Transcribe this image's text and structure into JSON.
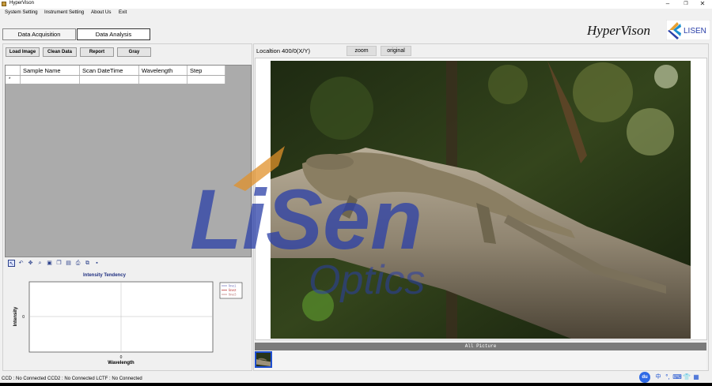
{
  "window": {
    "title": "HyperVison",
    "controls": [
      "–",
      "❐",
      "✕"
    ]
  },
  "menu": [
    "System Setting",
    "Instrument Setting",
    "About Us",
    "Exit"
  ],
  "tabs": {
    "acquisition": "Data Acquisition",
    "analysis": "Data Analysis"
  },
  "brand": {
    "name": "HyperVison",
    "logo_text": "LISEN"
  },
  "toolbar": {
    "load": "Load Image",
    "clean": "Clean Data",
    "report": "Report",
    "gray": "Gray"
  },
  "grid": {
    "columns": [
      "Sample Name",
      "Scan DateTime",
      "Wavelength",
      "Step"
    ],
    "new_row_marker": "*"
  },
  "chart_toolbar_icons": [
    "pointer-icon",
    "undo-icon",
    "pan-icon",
    "zoom-icon",
    "zoom-fit-icon",
    "copy-icon",
    "properties-icon",
    "print-icon",
    "export-icon",
    "save-icon"
  ],
  "chart_data": {
    "type": "line",
    "title": "Intensity Tendency",
    "xlabel": "Wavelength",
    "ylabel": "Intensity",
    "x_tick": "0",
    "y_tick": "0",
    "series": [
      {
        "name": "line1",
        "values": [],
        "color": "#8080c0"
      },
      {
        "name": "line2",
        "values": [],
        "color": "#c04040"
      },
      {
        "name": "line3",
        "values": [],
        "color": "#c08080"
      }
    ],
    "grid": true,
    "legend_position": "right"
  },
  "viewer": {
    "location_label": "Localtion 400/0(X/Y)",
    "zoom_button": "zoom",
    "original_button": "original",
    "all_picture_label": "All Picture"
  },
  "watermark": {
    "brand": "LiSen",
    "sub": "Optics"
  },
  "status": {
    "text": "CCD : No Connected  CCD2 : No Connected  LCTF : No Connected"
  },
  "tray": {
    "baidu": "du",
    "ime": "中"
  },
  "colors": {
    "accent": "#1f2f80",
    "watermark_blue": "#2a3fa8",
    "watermark_orange": "#e0902a"
  }
}
